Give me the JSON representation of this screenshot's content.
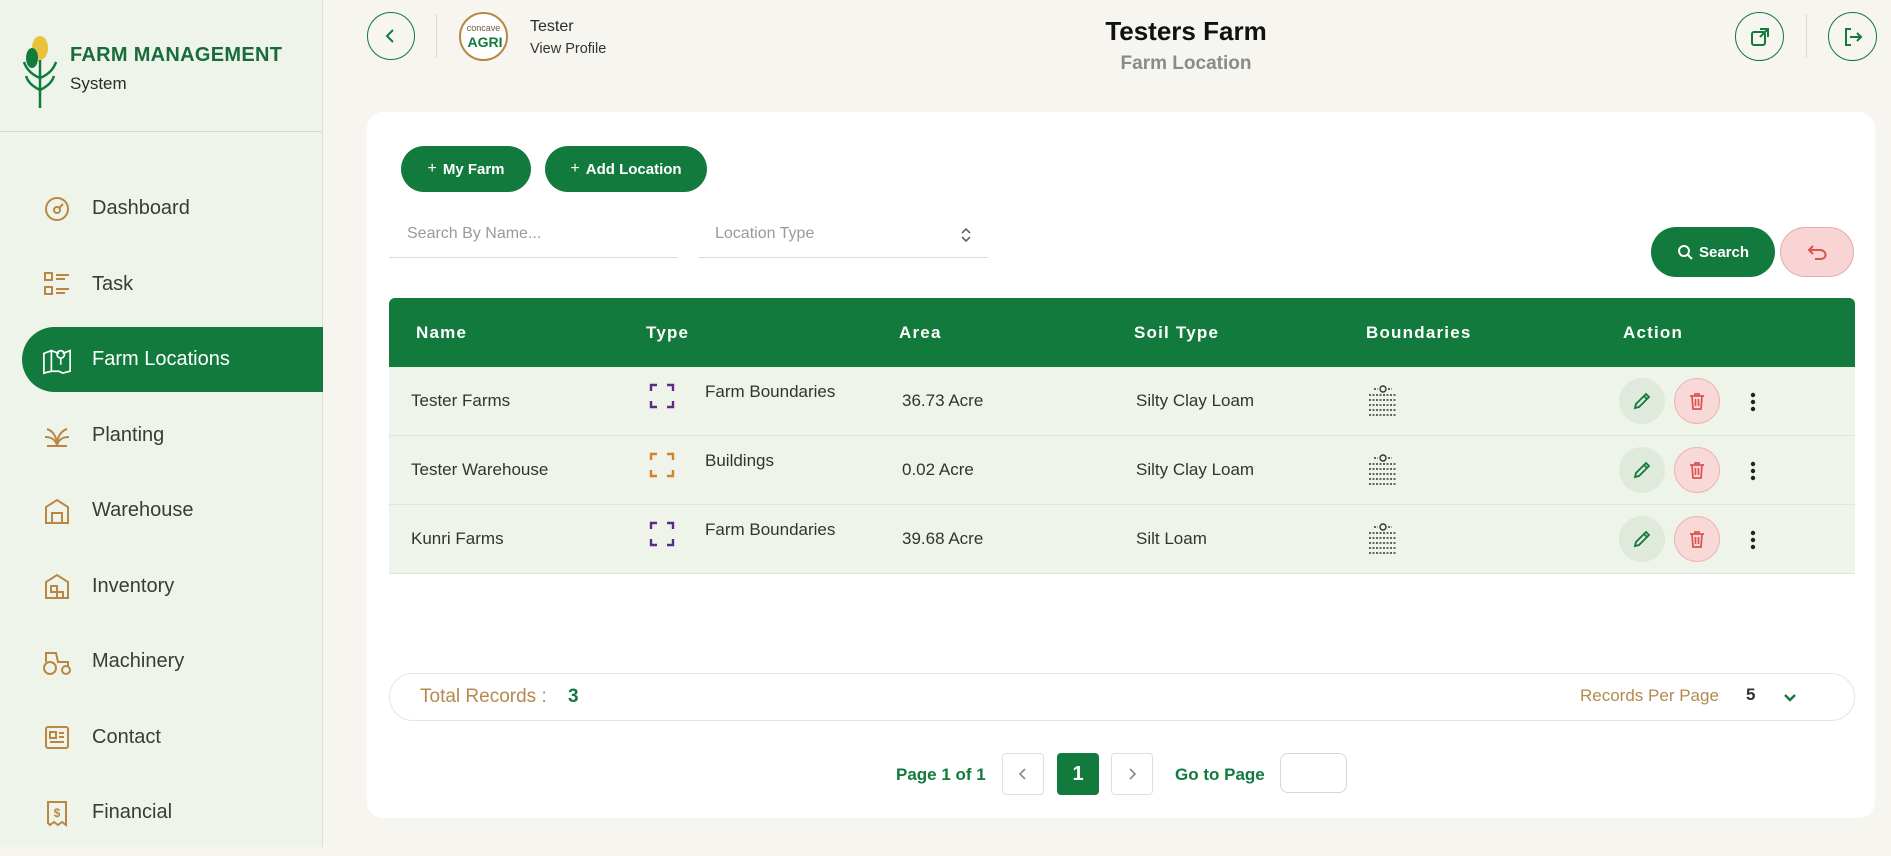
{
  "brand": {
    "title": "FARM MANAGEMENT",
    "subtitle": "System"
  },
  "sidebar": {
    "items": [
      {
        "label": "Dashboard",
        "icon": "gauge-icon",
        "active": false
      },
      {
        "label": "Task",
        "icon": "checklist-icon",
        "active": false
      },
      {
        "label": "Farm Locations",
        "icon": "map-pin-icon",
        "active": true
      },
      {
        "label": "Planting",
        "icon": "plant-icon",
        "active": false
      },
      {
        "label": "Warehouse",
        "icon": "warehouse-icon",
        "active": false
      },
      {
        "label": "Inventory",
        "icon": "inventory-icon",
        "active": false
      },
      {
        "label": "Machinery",
        "icon": "tractor-icon",
        "active": false
      },
      {
        "label": "Contact",
        "icon": "contact-card-icon",
        "active": false
      },
      {
        "label": "Financial",
        "icon": "receipt-dollar-icon",
        "active": false
      }
    ]
  },
  "header": {
    "user_name": "Tester",
    "view_profile": "View Profile",
    "avatar_text_top": "concave",
    "avatar_text_bottom": "AGRI",
    "title": "Testers Farm",
    "subtitle": "Farm Location"
  },
  "toolbar": {
    "my_farm_label": "My Farm",
    "add_location_label": "Add Location",
    "search_placeholder": "Search By Name...",
    "location_type_placeholder": "Location Type",
    "search_label": "Search"
  },
  "table": {
    "columns": [
      "Name",
      "Type",
      "Area",
      "Soil Type",
      "Boundaries",
      "Action"
    ],
    "rows": [
      {
        "name": "Tester Farms",
        "type": "Farm Boundaries",
        "type_color": "#5b2a86",
        "area": "36.73 Acre",
        "soil": "Silty Clay Loam"
      },
      {
        "name": "Tester Warehouse",
        "type": "Buildings",
        "type_color": "#d2832a",
        "area": "0.02 Acre",
        "soil": "Silty Clay Loam"
      },
      {
        "name": "Kunri Farms",
        "type": "Farm Boundaries",
        "type_color": "#5b2a86",
        "area": "39.68 Acre",
        "soil": "Silt Loam"
      }
    ]
  },
  "footer": {
    "total_label": "Total Records :",
    "total_value": "3",
    "rpp_label": "Records Per Page",
    "rpp_value": "5"
  },
  "pagination": {
    "info": "Page 1 of 1",
    "current": "1",
    "goto_label": "Go to Page"
  },
  "colors": {
    "primary": "#127a3d",
    "accent": "#b38a4f",
    "danger": "#d9534f"
  }
}
